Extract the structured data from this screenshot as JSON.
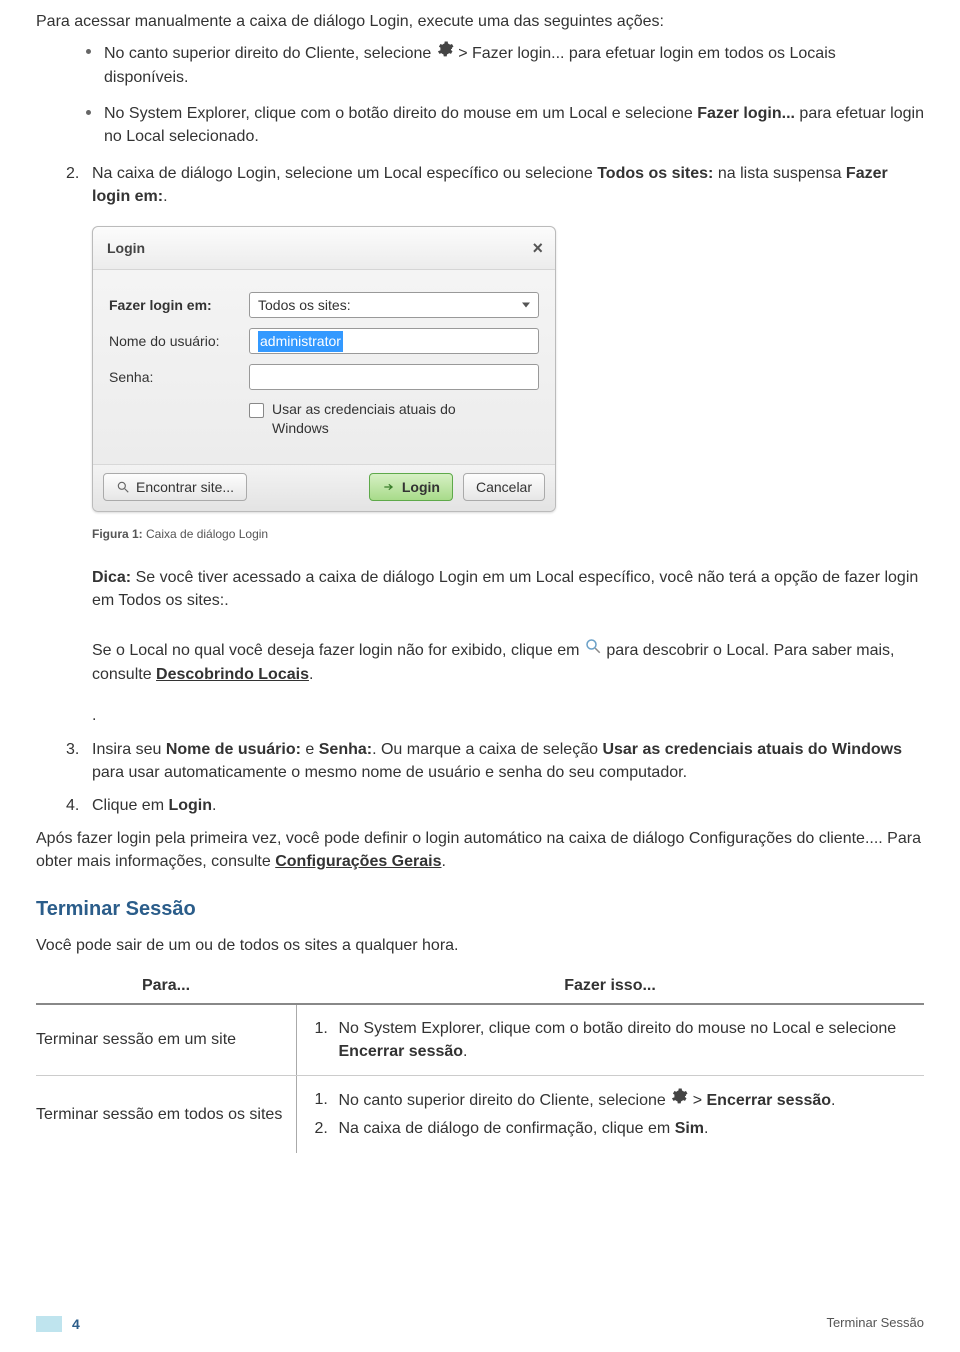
{
  "intro": "Para acessar manualmente a caixa de diálogo Login, execute uma das seguintes ações:",
  "bullet1_a": "No canto superior direito do Cliente, selecione ",
  "bullet1_b": " > Fazer login... para efetuar login em todos os Locais disponíveis.",
  "bullet2_a": "No System Explorer, clique com o botão direito do mouse em um Local e selecione ",
  "bullet2_b": "Fazer login...",
  "bullet2_c": " para efetuar login no Local selecionado.",
  "step2_num": "2.",
  "step2_a": "Na caixa de diálogo Login, selecione um Local específico ou selecione ",
  "step2_b": "Todos os sites:",
  "step2_c": " na lista suspensa ",
  "step2_d": "Fazer login em:",
  "step2_e": ".",
  "dialog": {
    "title": "Login",
    "label_site": "Fazer login em:",
    "select_value": "Todos os sites:",
    "label_user": "Nome do usuário:",
    "user_value": "administrator",
    "label_pass": "Senha:",
    "checkbox_label": "Usar as credenciais atuais do Windows",
    "btn_find": "Encontrar site...",
    "btn_login": "Login",
    "btn_cancel": "Cancelar"
  },
  "figure_label": "Figura 1:",
  "figure_text": " Caixa de diálogo Login",
  "tip_label": "Dica:",
  "tip_text": " Se você tiver acessado a caixa de diálogo Login em um Local específico, você não terá a opção de fazer login em Todos os sites:.",
  "discover_a": "Se o Local no qual você deseja fazer login não for exibido, clique em ",
  "discover_b": " para descobrir o Local. Para saber mais, consulte ",
  "discover_link": "Descobrindo Locais",
  "discover_c": ".",
  "dot_line": ".",
  "step3_num": "3.",
  "step3_a": "Insira seu ",
  "step3_b": "Nome de usuário:",
  "step3_c": " e ",
  "step3_d": "Senha:",
  "step3_e": ". Ou marque a caixa de seleção ",
  "step3_f": "Usar as credenciais atuais do Windows",
  "step3_g": " para usar automaticamente o mesmo nome de usuário e senha do seu computador.",
  "step4_num": "4.",
  "step4_a": "Clique em ",
  "step4_b": "Login",
  "step4_c": ".",
  "after_a": "Após fazer login pela primeira vez, você pode definir o login automático na caixa de diálogo Configurações do cliente.... Para obter mais informações, consulte ",
  "after_link": "Configurações Gerais",
  "after_b": ".",
  "section_title": "Terminar Sessão",
  "section_intro": "Você pode sair de um ou de todos os sites a qualquer hora.",
  "table": {
    "h1": "Para...",
    "h2": "Fazer isso...",
    "r1c1": "Terminar sessão em um site",
    "r1c2_num": "1.",
    "r1c2_a": "No System Explorer, clique com o botão direito do mouse no Local e selecione ",
    "r1c2_b": "Encerrar sessão",
    "r1c2_c": ".",
    "r2c1": "Terminar sessão em todos os sites",
    "r2c2_1_num": "1.",
    "r2c2_1_a": "No canto superior direito do Cliente, selecione ",
    "r2c2_1_b": " > ",
    "r2c2_1_c": "Encerrar sessão",
    "r2c2_1_d": ".",
    "r2c2_2_num": "2.",
    "r2c2_2_a": "Na caixa de diálogo de confirmação, clique em ",
    "r2c2_2_b": "Sim",
    "r2c2_2_c": "."
  },
  "footer": {
    "page": "4",
    "right": "Terminar Sessão"
  }
}
